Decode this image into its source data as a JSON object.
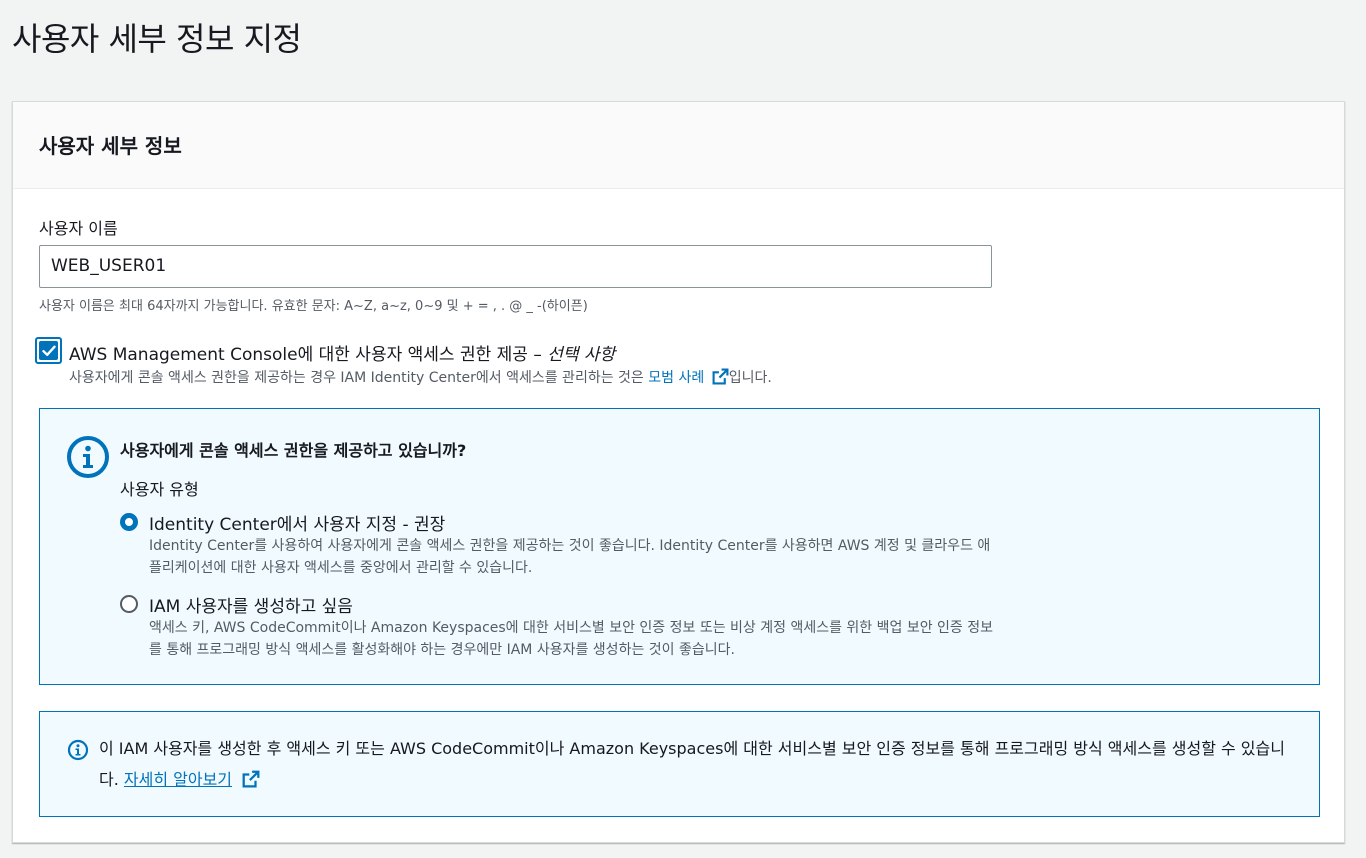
{
  "page": {
    "title": "사용자 세부 정보 지정"
  },
  "section": {
    "header": "사용자 세부 정보"
  },
  "username": {
    "label": "사용자 이름",
    "value": "WEB_USER01",
    "hint": "사용자 이름은 최대 64자까지 가능합니다. 유효한 문자: A~Z, a~z, 0~9 및 + = , . @ _ -(하이픈)"
  },
  "console_access": {
    "checked": true,
    "label_main": "AWS Management Console에 대한 사용자 액세스 권한 제공 – ",
    "label_optional": "선택 사항",
    "desc_before": "사용자에게 콘솔 액세스 권한을 제공하는 경우 IAM Identity Center에서 액세스를 관리하는 것은 ",
    "desc_link": "모범 사례",
    "desc_after": "입니다."
  },
  "console_info": {
    "title": "사용자에게 콘솔 액세스 권한을 제공하고 있습니까?",
    "user_type_label": "사용자 유형",
    "options": [
      {
        "label": "Identity Center에서 사용자 지정 - 권장",
        "desc": "Identity Center를 사용하여 사용자에게 콘솔 액세스 권한을 제공하는 것이 좋습니다. Identity Center를 사용하면 AWS 계정 및 클라우드 애플리케이션에 대한 사용자 액세스를 중앙에서 관리할 수 있습니다.",
        "selected": true
      },
      {
        "label": "IAM 사용자를 생성하고 싶음",
        "desc": "액세스 키, AWS CodeCommit이나 Amazon Keyspaces에 대한 서비스별 보안 인증 정보 또는 비상 계정 액세스를 위한 백업 보안 인증 정보를 통해 프로그래밍 방식 액세스를 활성화해야 하는 경우에만 IAM 사용자를 생성하는 것이 좋습니다.",
        "selected": false
      }
    ]
  },
  "iam_info": {
    "text": "이 IAM 사용자를 생성한 후 액세스 키 또는 AWS CodeCommit이나 Amazon Keyspaces에 대한 서비스별 보안 인증 정보를 통해 프로그래밍 방식 액세스를 생성할 수 있습니다. ",
    "link": "자세히 알아보기"
  },
  "colors": {
    "accent": "#0073bb",
    "info_bg": "#f1faff",
    "text": "#16191f",
    "muted": "#545b64",
    "page_bg": "#f2f3f3"
  }
}
